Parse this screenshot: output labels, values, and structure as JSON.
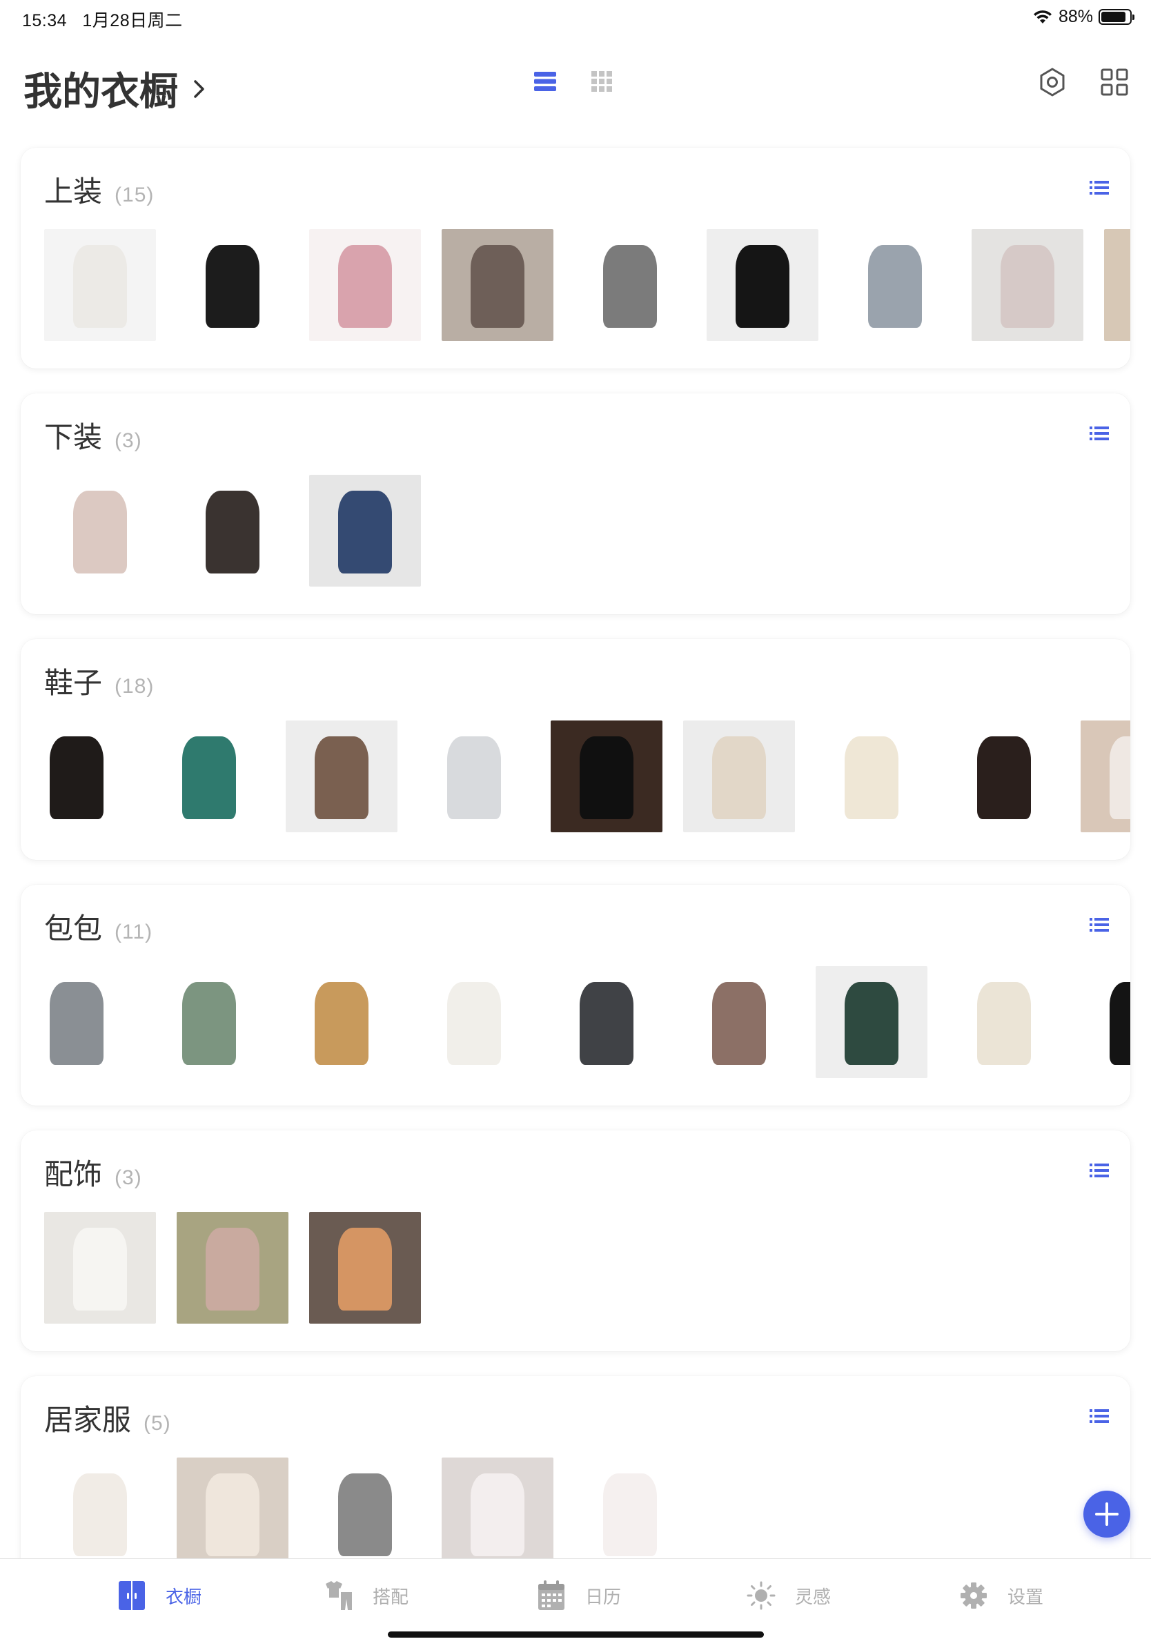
{
  "status_bar": {
    "time": "15:34",
    "date": "1月28日周二",
    "battery": "88%",
    "battery_level": 0.88
  },
  "header": {
    "title": "我的衣橱"
  },
  "categories": [
    {
      "title": "上装",
      "count": "(15)",
      "thumbs": [
        {
          "bg": "#f4f4f4",
          "fg": "#eceae6"
        },
        {
          "bg": "#ffffff",
          "fg": "#1c1c1c"
        },
        {
          "bg": "#f7f2f2",
          "fg": "#d9a3ad"
        },
        {
          "bg": "#b9aea4",
          "fg": "#6e5f58"
        },
        {
          "bg": "#ffffff",
          "fg": "#7b7b7b"
        },
        {
          "bg": "#eeeeee",
          "fg": "#151515"
        },
        {
          "bg": "#ffffff",
          "fg": "#9aa3ad"
        },
        {
          "bg": "#e4e3e1",
          "fg": "#d6c9c7"
        },
        {
          "bg": "#d7c8b6",
          "fg": "#8a7560"
        }
      ]
    },
    {
      "title": "下装",
      "count": "(3)",
      "thumbs": [
        {
          "bg": "#ffffff",
          "fg": "#dcc9c2"
        },
        {
          "bg": "#ffffff",
          "fg": "#3a3330"
        },
        {
          "bg": "#e6e6e6",
          "fg": "#344a72"
        }
      ]
    },
    {
      "title": "鞋子",
      "count": "(18)",
      "thumbs": [
        {
          "bg": "#ffffff",
          "fg": "#1f1b19"
        },
        {
          "bg": "#ffffff",
          "fg": "#2f7a6e"
        },
        {
          "bg": "#ededed",
          "fg": "#7a6050"
        },
        {
          "bg": "#ffffff",
          "fg": "#d8dadd"
        },
        {
          "bg": "#3b2a22",
          "fg": "#101010"
        },
        {
          "bg": "#ececec",
          "fg": "#e2d7c8"
        },
        {
          "bg": "#ffffff",
          "fg": "#efe7d6"
        },
        {
          "bg": "#ffffff",
          "fg": "#2a1f1c"
        },
        {
          "bg": "#d9c7b8",
          "fg": "#efe8e3"
        }
      ]
    },
    {
      "title": "包包",
      "count": "(11)",
      "thumbs": [
        {
          "bg": "#ffffff",
          "fg": "#8a8f94"
        },
        {
          "bg": "#ffffff",
          "fg": "#7c9580"
        },
        {
          "bg": "#ffffff",
          "fg": "#c89a5c"
        },
        {
          "bg": "#ffffff",
          "fg": "#f1efea"
        },
        {
          "bg": "#ffffff",
          "fg": "#404246"
        },
        {
          "bg": "#ffffff",
          "fg": "#8c7066"
        },
        {
          "bg": "#eeeeee",
          "fg": "#2e4a40"
        },
        {
          "bg": "#ffffff",
          "fg": "#ebe4d6"
        },
        {
          "bg": "#ffffff",
          "fg": "#141414"
        }
      ]
    },
    {
      "title": "配饰",
      "count": "(3)",
      "thumbs": [
        {
          "bg": "#e9e7e3",
          "fg": "#f6f5f2"
        },
        {
          "bg": "#a8a481",
          "fg": "#c9aa9f"
        },
        {
          "bg": "#6a5b52",
          "fg": "#d59563"
        }
      ]
    },
    {
      "title": "居家服",
      "count": "(5)",
      "thumbs": [
        {
          "bg": "#ffffff",
          "fg": "#f1ece6"
        },
        {
          "bg": "#d9cfc5",
          "fg": "#efe6dc"
        },
        {
          "bg": "#ffffff",
          "fg": "#8a8a8a"
        },
        {
          "bg": "#ded8d6",
          "fg": "#f3eeee"
        },
        {
          "bg": "#ffffff",
          "fg": "#f5f0ef"
        }
      ]
    }
  ],
  "tabs": [
    {
      "label": "衣橱",
      "icon": "wardrobe-icon",
      "active": true
    },
    {
      "label": "搭配",
      "icon": "outfit-icon",
      "active": false
    },
    {
      "label": "日历",
      "icon": "calendar-icon",
      "active": false
    },
    {
      "label": "灵感",
      "icon": "inspiration-icon",
      "active": false
    },
    {
      "label": "设置",
      "icon": "settings-icon",
      "active": false
    }
  ],
  "colors": {
    "accent": "#4a63e6",
    "inactive": "#b0b0b0",
    "count_gray": "#b4b4b4"
  }
}
